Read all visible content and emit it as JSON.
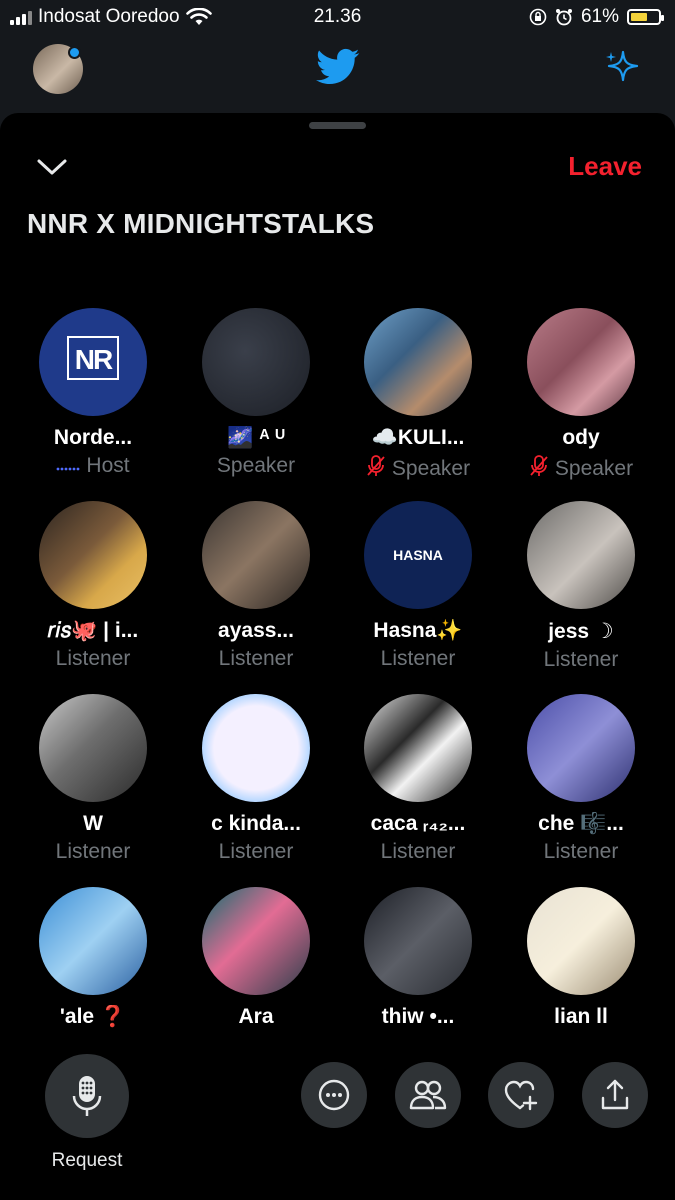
{
  "status_bar": {
    "carrier": "Indosat Ooredoo",
    "time": "21.36",
    "battery_percent": "61%",
    "battery_level": 0.61
  },
  "space": {
    "collapse_icon": "chevron-down-icon",
    "leave_label": "Leave",
    "title": "NNR X MIDNIGHTSTALKS"
  },
  "participants": [
    {
      "name": "Norde...",
      "role": "Host",
      "role_icon": "host-dots-icon",
      "avatar_text": "NR"
    },
    {
      "name": "🌌 ᴬ ᵁ",
      "role": "Speaker",
      "role_icon": "",
      "avatar_text": ""
    },
    {
      "name": "☁️KULI...",
      "role": "Speaker",
      "role_icon": "mic-muted-icon",
      "avatar_text": ""
    },
    {
      "name": "ody",
      "role": "Speaker",
      "role_icon": "mic-muted-icon",
      "avatar_text": ""
    },
    {
      "name": "𝑟𝑖𝑠🐙 | i...",
      "role": "Listener",
      "role_icon": "",
      "avatar_text": ""
    },
    {
      "name": "ayass...",
      "role": "Listener",
      "role_icon": "",
      "avatar_text": ""
    },
    {
      "name": "Hasna✨",
      "role": "Listener",
      "role_icon": "",
      "avatar_text": "HASNA"
    },
    {
      "name": "jess ☽",
      "role": "Listener",
      "role_icon": "",
      "avatar_text": ""
    },
    {
      "name": "W",
      "role": "Listener",
      "role_icon": "",
      "avatar_text": ""
    },
    {
      "name": "c kinda...",
      "role": "Listener",
      "role_icon": "",
      "avatar_text": ""
    },
    {
      "name": "caca ᵣ₄₂...",
      "role": "Listener",
      "role_icon": "",
      "avatar_text": ""
    },
    {
      "name": "che 🎼...",
      "role": "Listener",
      "role_icon": "",
      "avatar_text": ""
    },
    {
      "name": "'ale ❓",
      "role": "",
      "role_icon": "",
      "avatar_text": ""
    },
    {
      "name": "Ara",
      "role": "",
      "role_icon": "",
      "avatar_text": ""
    },
    {
      "name": "thiw •...",
      "role": "",
      "role_icon": "",
      "avatar_text": ""
    },
    {
      "name": "lian ll",
      "role": "",
      "role_icon": "",
      "avatar_text": ""
    }
  ],
  "bottom_bar": {
    "request_label": "Request",
    "buttons": [
      "more-icon",
      "people-icon",
      "heart-plus-icon",
      "share-icon"
    ]
  },
  "colors": {
    "accent_leave": "#f4212e",
    "twitter_blue": "#1d9bf0",
    "sheet_bg": "#000000",
    "muted_text": "#71767b"
  }
}
